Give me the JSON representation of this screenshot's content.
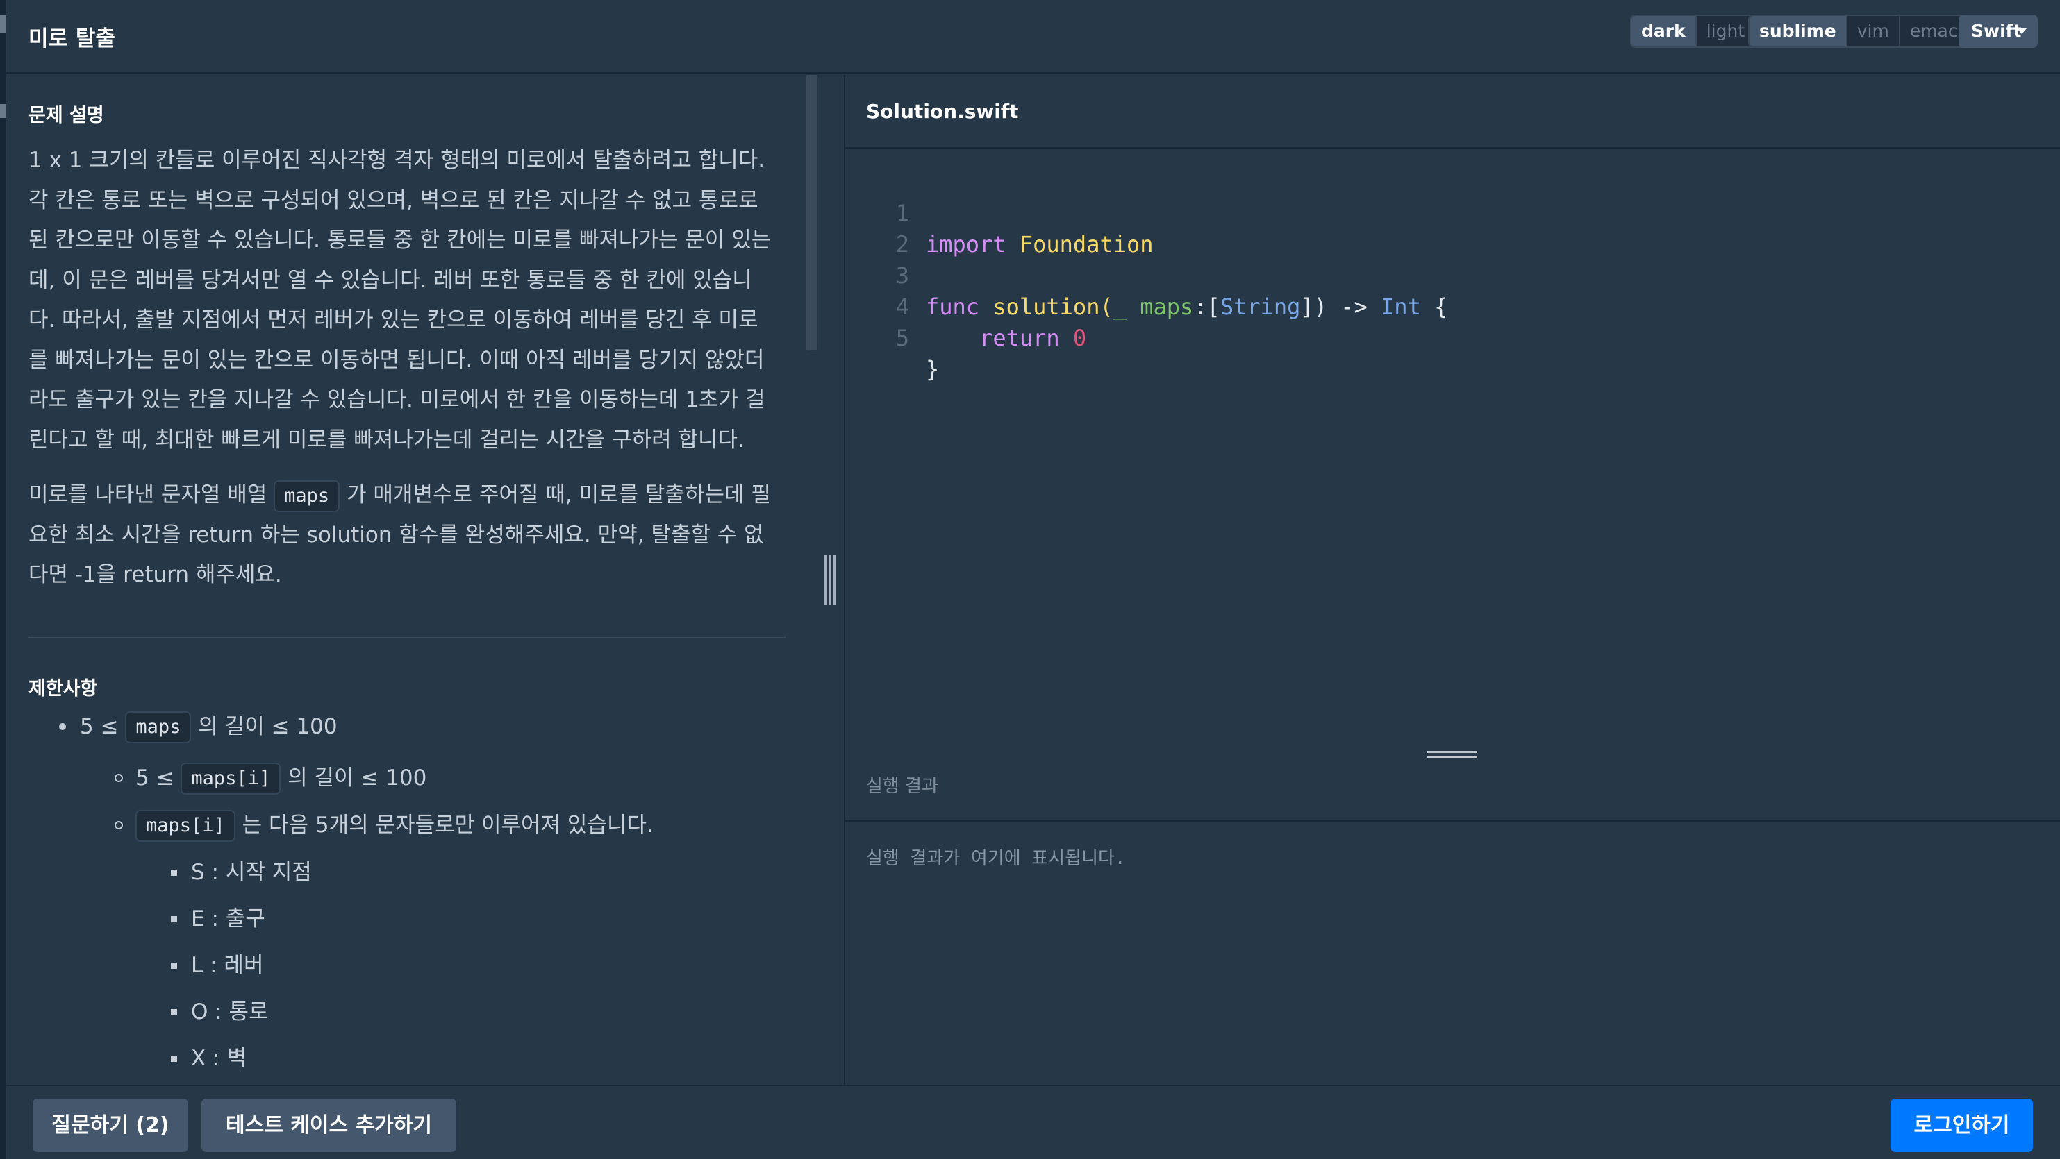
{
  "header": {
    "title": "미로 탈출",
    "theme_options": [
      "dark",
      "light"
    ],
    "theme_selected": "dark",
    "keymap_options": [
      "sublime",
      "vim",
      "emacs"
    ],
    "keymap_selected": "sublime",
    "language_selected": "Swift"
  },
  "problem": {
    "section_title": "문제 설명",
    "description_lines": [
      "1 x 1 크기의 칸들로 이루어진 직사각형 격자 형태의 미로에서 탈출하려고 합니다.",
      "각 칸은 통로 또는 벽으로 구성되어 있으며, 벽으로 된 칸은 지나갈 수 없고 통로로",
      "된 칸으로만 이동할 수 있습니다. 통로들 중 한 칸에는 미로를 빠져나가는 문이 있는",
      "데, 이 문은 레버를 당겨서만 열 수 있습니다. 레버 또한 통로들 중 한 칸에 있습니",
      "다. 따라서, 출발 지점에서 먼저 레버가 있는 칸으로 이동하여 레버를 당긴 후 미로",
      "를 빠져나가는 문이 있는 칸으로 이동하면 됩니다. 이때 아직 레버를 당기지 않았더",
      "라도 출구가 있는 칸을 지나갈 수 있습니다. 미로에서 한 칸을 이동하는데 1초가 걸",
      "린다고 할 때, 최대한 빠르게 미로를 빠져나가는데 걸리는 시간을 구하려 합니다."
    ],
    "para2_line1_pre": "미로를 나타낸 문자열 배열",
    "para2_line1_code": "maps",
    "para2_line1_post": "가 매개변수로 주어질 때, 미로를 탈출하는데 필",
    "para2_line2": "요한 최소 시간을 return 하는 solution 함수를 완성해주세요. 만약, 탈출할 수 없",
    "para2_line3": "다면 -1을 return 해주세요.",
    "constraints_title": "제한사항",
    "c1_pre": "5 ≤",
    "c1_code": "maps",
    "c1_post": "의 길이 ≤ 100",
    "c2_pre": "5 ≤",
    "c2_code": "maps[i]",
    "c2_post": "의 길이 ≤ 100",
    "c3_code": "maps[i]",
    "c3_post": "는 다음 5개의 문자들로만 이루어져 있습니다.",
    "chars": [
      "S : 시작 지점",
      "E : 출구",
      "L : 레버",
      "O : 통로",
      "X : 벽"
    ]
  },
  "editor": {
    "filename": "Solution.swift",
    "line_numbers": [
      "1",
      "2",
      "3",
      "4",
      "5"
    ],
    "code": {
      "l1_kw": "import",
      "l1_mod": "Foundation",
      "l3_kw": "func",
      "l3_fn": "solution",
      "l3_open": "(",
      "l3_under": "_",
      "l3_param": "maps",
      "l3_colon": ":[",
      "l3_type": "String",
      "l3_arrow": "]) ->",
      "l3_ret": "Int",
      "l3_brace": "{",
      "l4_kw": "return",
      "l4_num": "0",
      "l5": "}"
    }
  },
  "result": {
    "label": "실행 결과",
    "placeholder": "실행 결과가 여기에 표시됩니다."
  },
  "footer": {
    "question_button": "질문하기 (2)",
    "add_testcase_button": "테스트 케이스 추가하기",
    "login_button": "로그인하기"
  }
}
